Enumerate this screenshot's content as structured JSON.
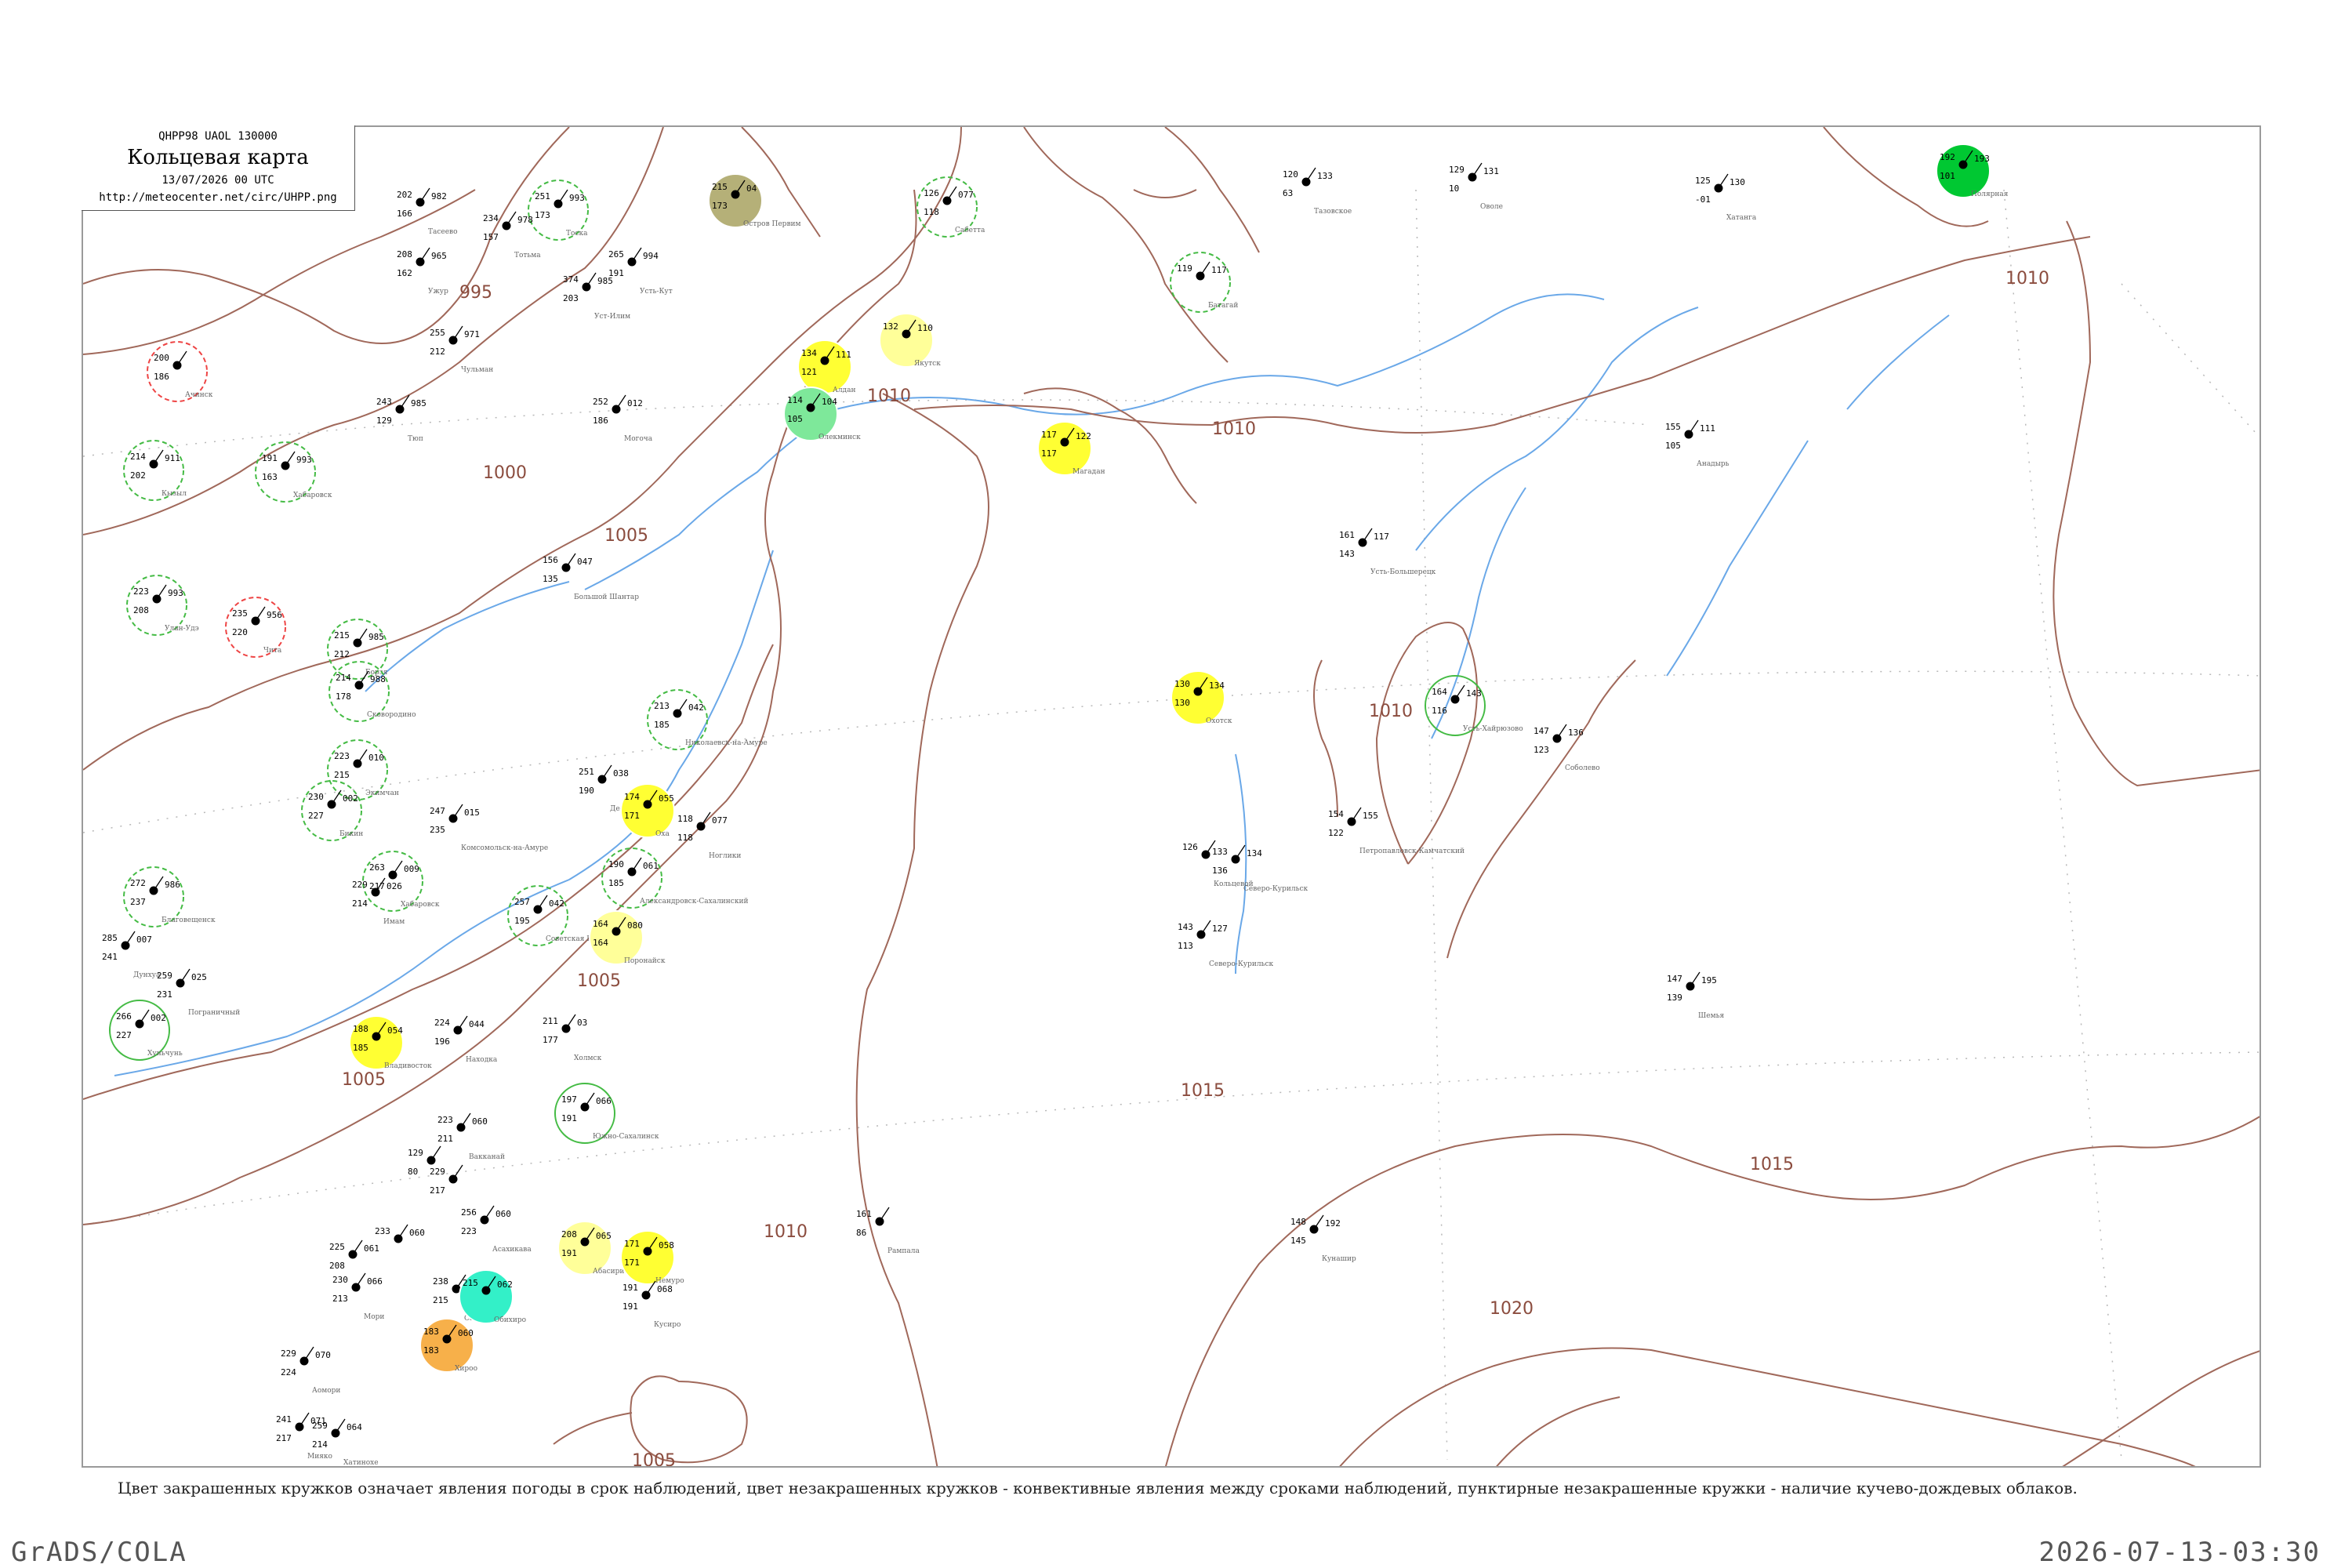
{
  "header": {
    "code": "QHPP98 UAOL 130000",
    "title": "Кольцевая карта",
    "datetime": "13/07/2026 00 UTC",
    "url": "http://meteocenter.net/circ/UHPP.png"
  },
  "caption": "Цвет закрашенных кружков означает явления погоды в срок наблюдений, цвет незакрашенных кружков - конвективные явления между сроками наблюдений, пунктирные незакрашенные кружки - наличие кучево-дождевых облаков.",
  "footer": {
    "left": "GrADS/COLA",
    "right": "2026-07-13-03:30"
  },
  "colors": {
    "isobar": "#a0685a",
    "river": "#6aa8e8",
    "grid": "#b8b8b8",
    "rain_green": "#00c832",
    "light_green": "#7ee89a",
    "yellow": "#ffff33",
    "pale_yellow": "#ffff99",
    "orange": "#f7b04a",
    "cyan": "#33f0c8",
    "olive": "#b5b078",
    "dash_green": "#44bb44",
    "dash_red": "#ee4444"
  },
  "isobars": [
    "995",
    "1000",
    "1005",
    "1010",
    "1015",
    "1020"
  ],
  "stations": [
    {
      "t": "215",
      "td": "173",
      "v": "04",
      "name": "Остров Первим",
      "fill": "olive"
    },
    {
      "t": "126",
      "td": "118",
      "v": "077",
      "name": "Сабетта",
      "ring": "dash_green"
    },
    {
      "t": "120",
      "td": "63",
      "v": "133",
      "name": "Тазовское"
    },
    {
      "t": "129",
      "td": "10",
      "v": "131",
      "name": "Оволе"
    },
    {
      "t": "125",
      "td": "-01",
      "v": "130",
      "name": "Хатанга"
    },
    {
      "t": "192",
      "td": "101",
      "v": "193",
      "name": "Полярная",
      "fill": "rain_green"
    },
    {
      "t": "251",
      "td": "173",
      "v": "993",
      "name": "Тоска",
      "ring": "dash_green"
    },
    {
      "t": "234",
      "td": "157",
      "v": "978",
      "name": "Тотьма"
    },
    {
      "t": "202",
      "td": "166",
      "v": "982",
      "name": "Тасеево"
    },
    {
      "t": "208",
      "td": "162",
      "v": "965",
      "name": "Ужур"
    },
    {
      "t": "374",
      "td": "203",
      "v": "985",
      "name": "Уст-Илим"
    },
    {
      "t": "265",
      "td": "191",
      "v": "994",
      "name": "Усть-Кут"
    },
    {
      "t": "119",
      "td": "",
      "v": "117",
      "name": "Батагай",
      "ring": "dash_green"
    },
    {
      "t": "134",
      "td": "121",
      "v": "111",
      "name": "Алдан",
      "fill": "yellow"
    },
    {
      "t": "132",
      "td": "",
      "v": "110",
      "name": "Якутск",
      "fill": "pale_yellow"
    },
    {
      "t": "114",
      "td": "105",
      "v": "104",
      "name": "Олекминск",
      "fill": "light_green"
    },
    {
      "t": "200",
      "td": "186",
      "v": "",
      "name": "Ачинск",
      "ring": "dash_red"
    },
    {
      "t": "255",
      "td": "212",
      "v": "971",
      "name": "Чульман"
    },
    {
      "t": "252",
      "td": "186",
      "v": "012",
      "name": "Могоча"
    },
    {
      "t": "243",
      "td": "129",
      "v": "985",
      "name": "Тюп"
    },
    {
      "t": "191",
      "td": "163",
      "v": "993",
      "name": "Хабаровск",
      "ring": "dash_green"
    },
    {
      "t": "214",
      "td": "202",
      "v": "911",
      "name": "Кызыл",
      "ring": "dash_green"
    },
    {
      "t": "117",
      "td": "117",
      "v": "122",
      "name": "Магадан",
      "fill": "yellow"
    },
    {
      "t": "155",
      "td": "105",
      "v": "111",
      "name": "Анадырь"
    },
    {
      "t": "161",
      "td": "143",
      "v": "117",
      "name": "Усть-Большерецк"
    },
    {
      "t": "156",
      "td": "135",
      "v": "047",
      "name": "Большой Шантар"
    },
    {
      "t": "223",
      "td": "208",
      "v": "993",
      "name": "Улан-Удэ",
      "ring": "dash_green"
    },
    {
      "t": "235",
      "td": "220",
      "v": "956",
      "name": "Чита",
      "ring": "dash_red"
    },
    {
      "t": "215",
      "td": "212",
      "v": "985",
      "name": "Борзя",
      "ring": "dash_green"
    },
    {
      "t": "214",
      "td": "178",
      "v": "988",
      "name": "Сковородино",
      "ring": "dash_green"
    },
    {
      "t": "130",
      "td": "130",
      "v": "134",
      "name": "Охотск",
      "fill": "yellow"
    },
    {
      "t": "164",
      "td": "116",
      "v": "143",
      "name": "Усть-Хайрюзово",
      "ring": "solid_green"
    },
    {
      "t": "147",
      "td": "123",
      "v": "136",
      "name": "Соболево"
    },
    {
      "t": "213",
      "td": "185",
      "v": "042",
      "name": "Николаевск-на-Амуре",
      "ring": "dash_green"
    },
    {
      "t": "251",
      "td": "190",
      "v": "038",
      "name": "Де-Кастри"
    },
    {
      "t": "174",
      "td": "171",
      "v": "055",
      "name": "Оха",
      "fill": "yellow"
    },
    {
      "t": "118",
      "td": "118",
      "v": "077",
      "name": "Ноглики"
    },
    {
      "t": "154",
      "td": "122",
      "v": "155",
      "name": "Петропавловск-Камчатский"
    },
    {
      "t": "223",
      "td": "215",
      "v": "010",
      "name": "Экимчан",
      "ring": "dash_green"
    },
    {
      "t": "247",
      "td": "235",
      "v": "015",
      "name": "Комсомольск-на-Амуре"
    },
    {
      "t": "230",
      "td": "227",
      "v": "002",
      "name": "Бикин",
      "ring": "dash_green"
    },
    {
      "t": "263",
      "td": "217",
      "v": "009",
      "name": "Хабаровск",
      "ring": "dash_green"
    },
    {
      "t": "190",
      "td": "185",
      "v": "061",
      "name": "Александровск-Сахалинский",
      "ring": "dash_green"
    },
    {
      "t": "126",
      "td": "",
      "v": "",
      "name": "Кольцевой"
    },
    {
      "t": "133",
      "td": "136",
      "v": "134",
      "name": "Северо-Курильск"
    },
    {
      "t": "272",
      "td": "237",
      "v": "986",
      "name": "Благовещенск",
      "ring": "dash_green"
    },
    {
      "t": "229",
      "td": "214",
      "v": "026",
      "name": "Имам"
    },
    {
      "t": "257",
      "td": "195",
      "v": "042",
      "name": "Советская Гавань",
      "ring": "dash_green"
    },
    {
      "t": "164",
      "td": "164",
      "v": "080",
      "name": "Поронайск",
      "fill": "pale_yellow"
    },
    {
      "t": "143",
      "td": "113",
      "v": "127",
      "name": "Северо-Курильск"
    },
    {
      "t": "147",
      "td": "139",
      "v": "195",
      "name": "Шемья"
    },
    {
      "t": "285",
      "td": "241",
      "v": "007",
      "name": "Дунхуа"
    },
    {
      "t": "259",
      "td": "231",
      "v": "025",
      "name": "Пограничный"
    },
    {
      "t": "266",
      "td": "227",
      "v": "002",
      "name": "Хуньчунь",
      "ring": "solid_green"
    },
    {
      "t": "188",
      "td": "185",
      "v": "054",
      "name": "Владивосток",
      "fill": "yellow"
    },
    {
      "t": "224",
      "td": "196",
      "v": "044",
      "name": "Находка"
    },
    {
      "t": "211",
      "td": "177",
      "v": "03",
      "name": "Холмск"
    },
    {
      "t": "197",
      "td": "191",
      "v": "066",
      "name": "Южно-Сахалинск",
      "ring": "solid_green"
    },
    {
      "t": "129",
      "td": "80",
      "v": "",
      "name": ""
    },
    {
      "t": "223",
      "td": "211",
      "v": "060",
      "name": "Вакканай"
    },
    {
      "t": "229",
      "td": "217",
      "v": "",
      "name": ""
    },
    {
      "t": "233",
      "td": "",
      "v": "060",
      "name": ""
    },
    {
      "t": "225",
      "td": "208",
      "v": "061",
      "name": ""
    },
    {
      "t": "256",
      "td": "223",
      "v": "060",
      "name": "Асахикава"
    },
    {
      "t": "208",
      "td": "191",
      "v": "065",
      "name": "Абасири",
      "fill": "pale_yellow"
    },
    {
      "t": "171",
      "td": "171",
      "v": "058",
      "name": "Немуро",
      "fill": "yellow"
    },
    {
      "t": "191",
      "td": "191",
      "v": "068",
      "name": "Кусиро"
    },
    {
      "t": "161",
      "td": "86",
      "v": "",
      "name": "Рампала"
    },
    {
      "t": "148",
      "td": "145",
      "v": "192",
      "name": "Кунашир"
    },
    {
      "t": "230",
      "td": "213",
      "v": "066",
      "name": "Мори"
    },
    {
      "t": "238",
      "td": "215",
      "v": "058",
      "name": "Саппоро"
    },
    {
      "t": "215",
      "td": "",
      "v": "062",
      "name": "Обихиро",
      "fill": "cyan"
    },
    {
      "t": "183",
      "td": "183",
      "v": "060",
      "name": "Хироо",
      "fill": "orange"
    },
    {
      "t": "229",
      "td": "224",
      "v": "070",
      "name": "Аомори"
    },
    {
      "t": "241",
      "td": "217",
      "v": "071",
      "name": "Мияко"
    },
    {
      "t": "259",
      "td": "214",
      "v": "064",
      "name": "Хатинохе"
    }
  ]
}
